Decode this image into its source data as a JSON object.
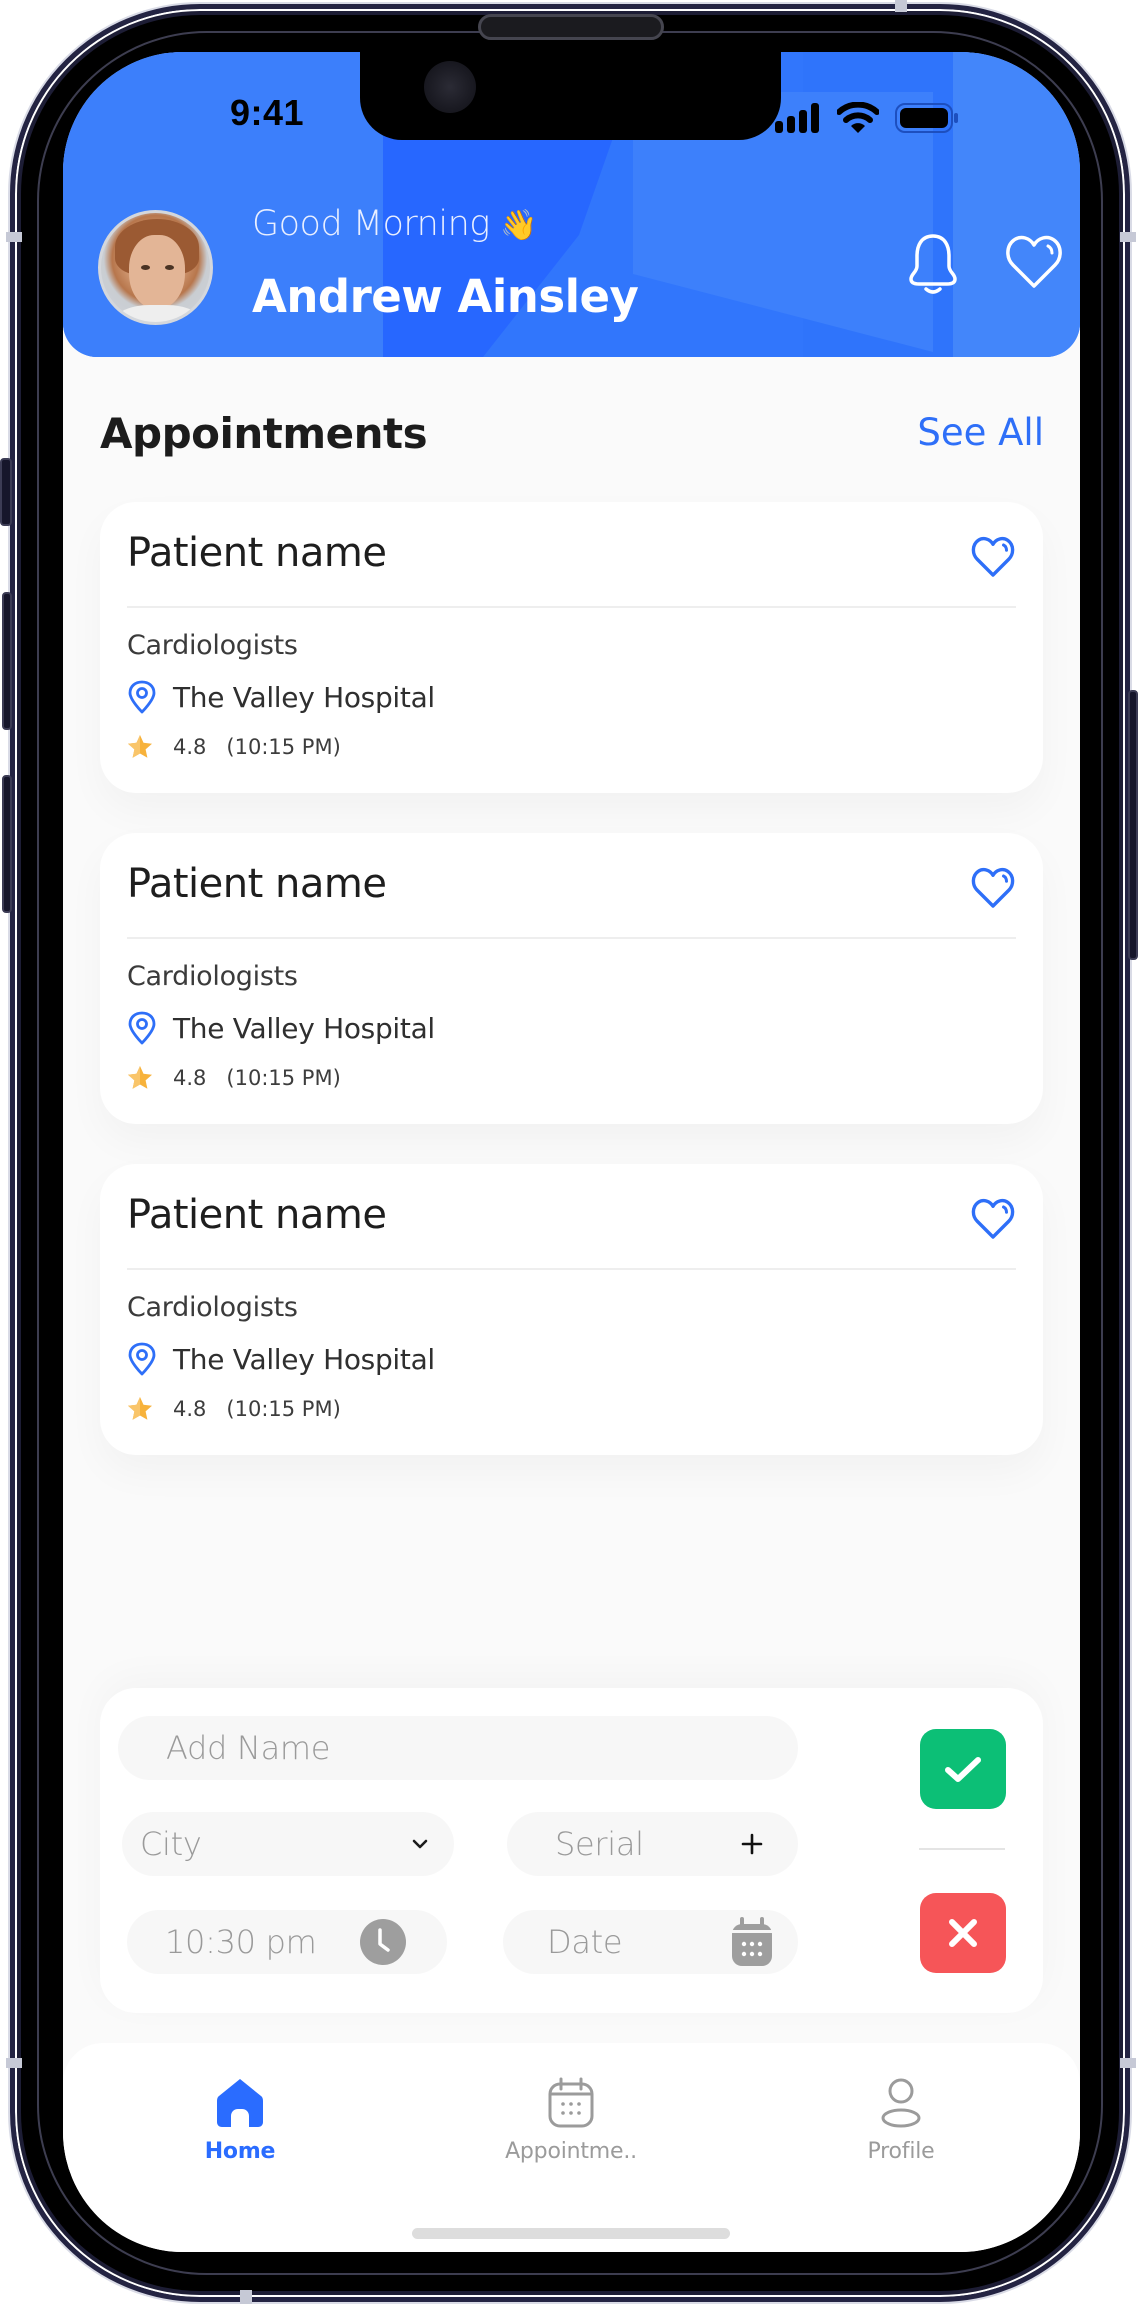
{
  "status_bar": {
    "time": "9:41"
  },
  "header": {
    "greeting": "Good Morning",
    "greeting_emoji": "👋",
    "user_name": "Andrew Ainsley",
    "icons": [
      "bell-icon",
      "heart-icon"
    ]
  },
  "appointments": {
    "title": "Appointments",
    "see_all_label": "See All",
    "items": [
      {
        "patient_name": "Patient name",
        "specialty": "Cardiologists",
        "hospital": "The Valley Hospital",
        "rating": "4.8",
        "time": "(10:15 PM)"
      },
      {
        "patient_name": "Patient name",
        "specialty": "Cardiologists",
        "hospital": "The Valley Hospital",
        "rating": "4.8",
        "time": "(10:15 PM)"
      },
      {
        "patient_name": "Patient name",
        "specialty": "Cardiologists",
        "hospital": "The Valley Hospital",
        "rating": "4.8",
        "time": "(10:15 PM)"
      }
    ]
  },
  "form": {
    "name_placeholder": "Add Name",
    "city_placeholder": "City",
    "serial_placeholder": "Serial",
    "time_value": "10:30 pm",
    "date_placeholder": "Date"
  },
  "bottom_nav": {
    "items": [
      {
        "label": "Home",
        "icon": "home-icon",
        "active": true
      },
      {
        "label": "Appointme..",
        "icon": "calendar-icon",
        "active": false
      },
      {
        "label": "Profile",
        "icon": "profile-icon",
        "active": false
      }
    ]
  },
  "colors": {
    "primary": "#2f74fb",
    "accent_text": "#2e6ff8",
    "confirm": "#0cbf76",
    "cancel": "#f65558",
    "star": "#f7b23b",
    "muted": "#9a9a9a"
  }
}
